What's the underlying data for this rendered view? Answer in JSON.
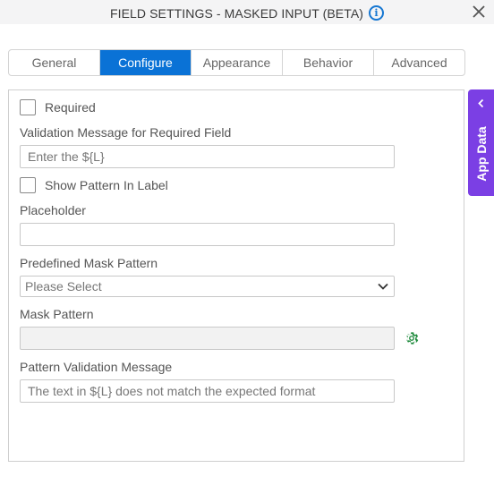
{
  "header": {
    "title": "FIELD SETTINGS - MASKED INPUT (BETA)",
    "info_icon": "info-icon",
    "close_icon": "close-icon"
  },
  "tabs": [
    {
      "label": "General",
      "active": false
    },
    {
      "label": "Configure",
      "active": true
    },
    {
      "label": "Appearance",
      "active": false
    },
    {
      "label": "Behavior",
      "active": false
    },
    {
      "label": "Advanced",
      "active": false
    }
  ],
  "form": {
    "required": {
      "label": "Required",
      "checked": false
    },
    "validation_message": {
      "label": "Validation Message for Required Field",
      "placeholder": "Enter the ${L}",
      "value": ""
    },
    "show_pattern": {
      "label": "Show Pattern In Label",
      "checked": false
    },
    "placeholder": {
      "label": "Placeholder",
      "value": ""
    },
    "predefined_mask": {
      "label": "Predefined Mask Pattern",
      "selected": "Please Select"
    },
    "mask_pattern": {
      "label": "Mask Pattern",
      "value": "",
      "disabled": true,
      "settings_icon": "gear-icon"
    },
    "pattern_validation": {
      "label": "Pattern Validation Message",
      "placeholder": "The text in ${L} does not match the expected format",
      "value": ""
    }
  },
  "side_panel": {
    "label": "App Data",
    "icon": "chevron-left-icon"
  },
  "colors": {
    "accent": "#0a72d6",
    "app_data": "#7b3fe4",
    "gear": "#1e8a3c",
    "info": "#1677d2"
  }
}
